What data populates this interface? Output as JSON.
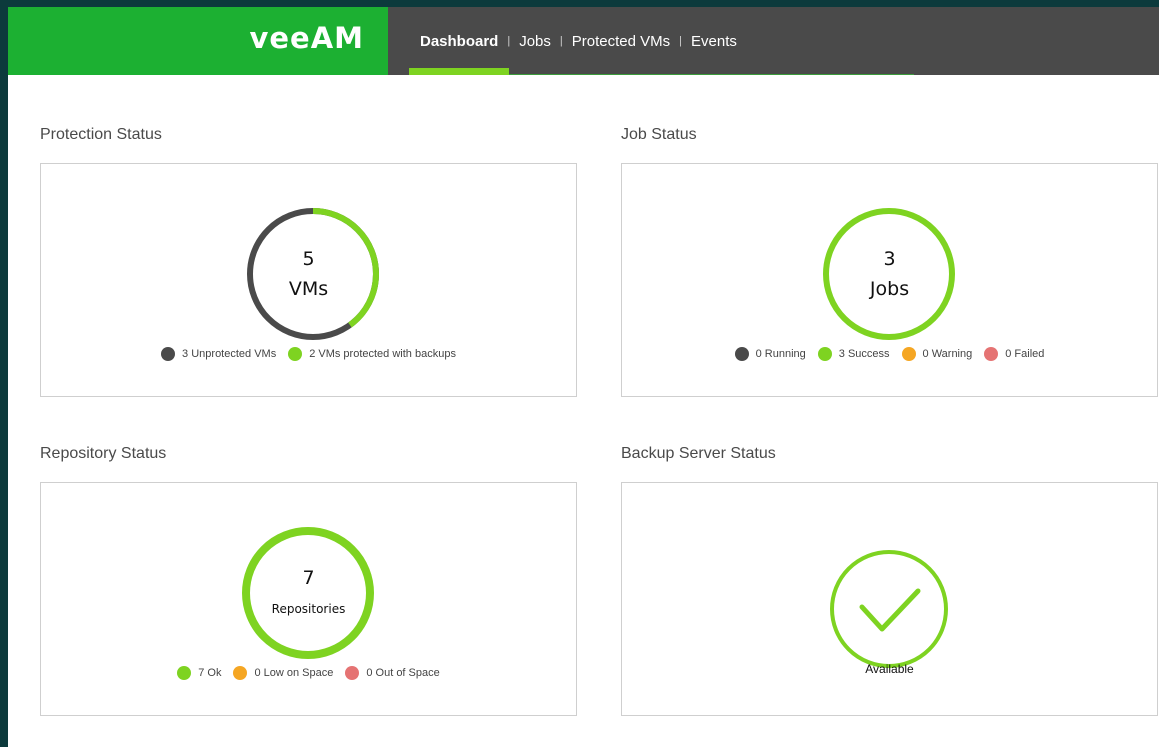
{
  "brand": {
    "logo_text": "veeAM"
  },
  "nav": {
    "separator": "|",
    "items": [
      {
        "label": "Dashboard",
        "active": true
      },
      {
        "label": "Jobs",
        "active": false
      },
      {
        "label": "Protected VMs",
        "active": false
      },
      {
        "label": "Events",
        "active": false
      }
    ]
  },
  "colors": {
    "brand_green": "#1cb032",
    "accent_green": "#7ed321",
    "dark_gray": "#4a4a4a",
    "warning_orange": "#f5a623",
    "failed_red": "#e57373"
  },
  "protection_status": {
    "title": "Protection Status",
    "count": "5",
    "unit": "VMs",
    "protected_fraction": 0.4,
    "legend": [
      {
        "label": "3 Unprotected VMs",
        "color": "#4a4a4a"
      },
      {
        "label": "2 VMs protected with backups",
        "color": "#7ed321"
      }
    ]
  },
  "job_status": {
    "title": "Job Status",
    "count": "3",
    "unit": "Jobs",
    "legend": [
      {
        "label": "0 Running",
        "color": "#4a4a4a"
      },
      {
        "label": "3 Success",
        "color": "#7ed321"
      },
      {
        "label": "0 Warning",
        "color": "#f5a623"
      },
      {
        "label": "0 Failed",
        "color": "#e57373"
      }
    ]
  },
  "repository_status": {
    "title": "Repository Status",
    "count": "7",
    "unit": "Repositories",
    "legend": [
      {
        "label": "7 Ok",
        "color": "#7ed321"
      },
      {
        "label": "0 Low on Space",
        "color": "#f5a623"
      },
      {
        "label": "0 Out of Space",
        "color": "#e57373"
      }
    ]
  },
  "backup_server_status": {
    "title": "Backup Server Status",
    "status": "Available",
    "icon": "checkmark-icon"
  }
}
